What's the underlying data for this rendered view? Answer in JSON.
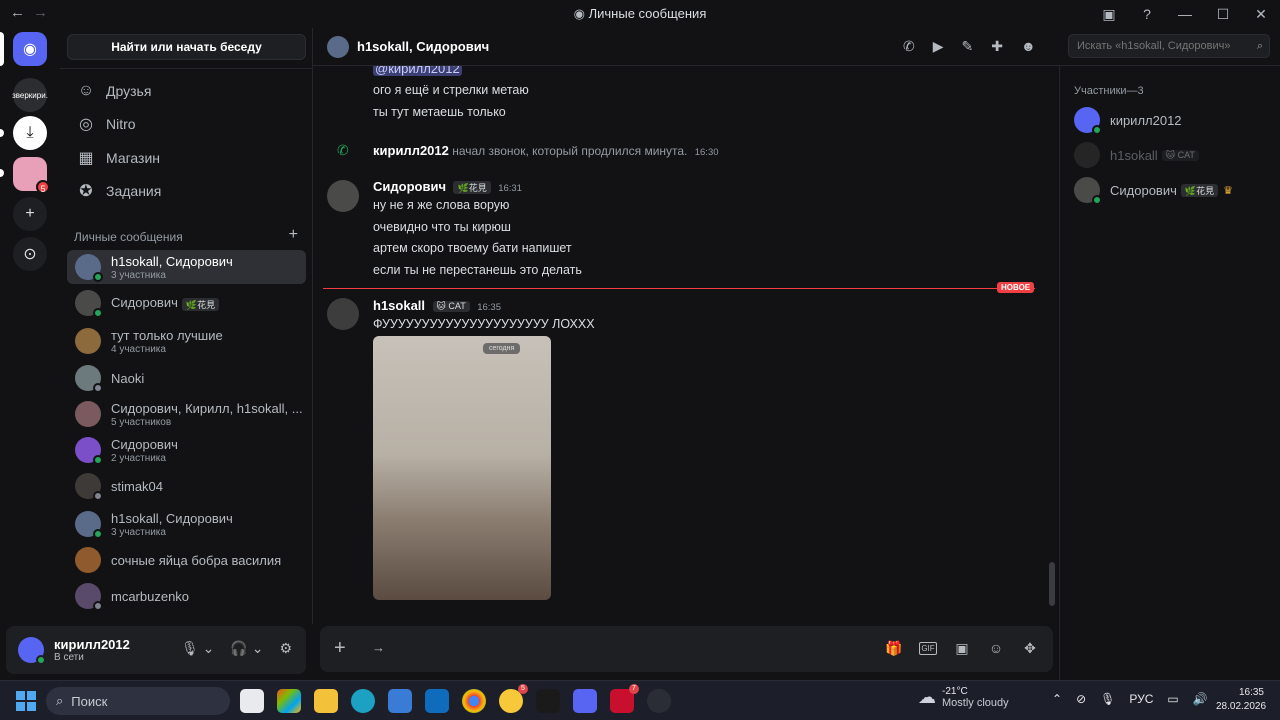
{
  "window": {
    "title": "Личные сообщения",
    "back": "←",
    "forward": "→",
    "controls": [
      "▣",
      "?",
      "—",
      "☐",
      "✕"
    ]
  },
  "servers": {
    "home_glyph": "◉",
    "srv1_text": "зверкири.",
    "srv2_glyph": "⤓",
    "srv3_badge": "5",
    "add_glyph": "+",
    "explore_glyph": "⊙"
  },
  "dm_sidebar": {
    "search_label": "Найти или начать беседу",
    "nav": [
      {
        "label": "Друзья",
        "icon": "friends-icon"
      },
      {
        "label": "Nitro",
        "icon": "nitro-icon"
      },
      {
        "label": "Магазин",
        "icon": "shop-icon"
      },
      {
        "label": "Задания",
        "icon": "quests-icon"
      }
    ],
    "section_title": "Личные сообщения",
    "section_add": "+",
    "dms": [
      {
        "name": "h1sokall, Сидорович",
        "sub": "3 участника",
        "active": true
      },
      {
        "name": "Сидорович",
        "tag": "🌿花見",
        "sub": ""
      },
      {
        "name": "тут только лучшие",
        "sub": "4 участника"
      },
      {
        "name": "Naoki",
        "sub": ""
      },
      {
        "name": "Сидорович, Кирилл, h1sokall, ...",
        "sub": "5 участников"
      },
      {
        "name": "Сидорович",
        "sub": "2 участника"
      },
      {
        "name": "stimak04",
        "sub": ""
      },
      {
        "name": "h1sokall, Сидорович",
        "sub": "3 участника"
      },
      {
        "name": "сочные яйца бобра василия",
        "sub": ""
      },
      {
        "name": "mcarbuzenko",
        "sub": ""
      }
    ]
  },
  "user_panel": {
    "name": "кирилл2012",
    "status": "В сети"
  },
  "chat_header": {
    "title": "h1sokall, Сидорович",
    "search_placeholder": "Искать «h1sokall, Сидорович»"
  },
  "messages": {
    "mention": "@кирилл2012",
    "lines_top": [
      "ого я ещё и стрелки метаю",
      "ты тут метаешь только"
    ],
    "call": {
      "author": "кирилл2012",
      "text": "начал звонок, который продлился минута.",
      "time": "16:30"
    },
    "msg1": {
      "author": "Сидорович",
      "tag": "🌿花見",
      "time": "16:31",
      "lines": [
        "ну не я же слова ворую",
        "очевидно что ты кирюш",
        "артем скоро твоему бати напишет",
        "если ты не перестанешь это делать"
      ]
    },
    "new_label": "НОВОЕ",
    "msg2": {
      "author": "h1sokall",
      "tag": "🐱 CAT",
      "time": "16:35",
      "text": "ФУУУУУУУУУУУУУУУУУУУУУ ЛОХХХ",
      "image_label": "сегодня"
    }
  },
  "members": {
    "header": "Участники—3",
    "list": [
      {
        "name": "кирилл2012",
        "online": true
      },
      {
        "name": "h1sokall",
        "tag": "🐱 CAT",
        "online": false
      },
      {
        "name": "Сидорович",
        "tag": "🌿花見",
        "online": true,
        "owner": true
      }
    ]
  },
  "taskbar": {
    "search": "Поиск",
    "weather_temp": "-21°C",
    "weather_desc": "Mostly cloudy",
    "lang": "РУС",
    "time": "16:35",
    "date": "28.02.2026",
    "app_badges": [
      "5",
      "7"
    ]
  },
  "colors": {
    "accent": "#5865f2",
    "online": "#23a55a",
    "new": "#f23f43",
    "bg": "#121214"
  }
}
